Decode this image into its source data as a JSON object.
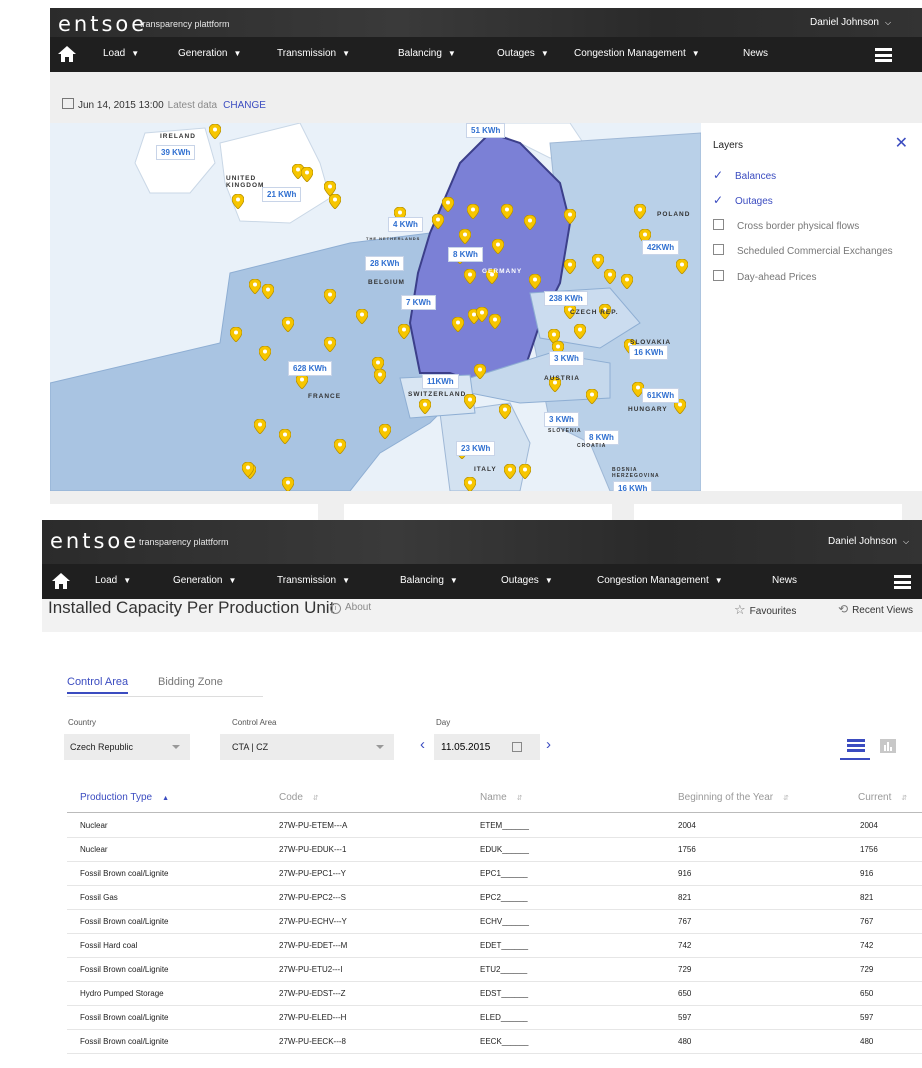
{
  "screenA": {
    "brand": "entsoe",
    "brand_e": "e",
    "tagline": "transparency plattform",
    "user": "Daniel Johnson",
    "nav": [
      "Load",
      "Generation",
      "Transmission",
      "Balancing",
      "Outages",
      "Congestion Management",
      "News"
    ],
    "date": "Jun 14, 2015 13:00",
    "latest": "Latest data",
    "change": "CHANGE",
    "map": {
      "values": [
        "39 KWh",
        "21 KWh",
        "4 KWh",
        "8 KWh",
        "28 KWh",
        "7 KWh",
        "51 KWh",
        "42KWh",
        "238 KWh",
        "628 KWh",
        "11KWh",
        "3 KWh",
        "8 KWh",
        "61KWh",
        "16 KWh",
        "3 KWh",
        "23 KWh",
        "16 KWh"
      ],
      "countries": [
        "IRELAND",
        "UNITED KINGDOM",
        "POLAND",
        "GERMANY",
        "BELGIUM",
        "CZECH REP.",
        "SLOVAKIA",
        "AUSTRIA",
        "HUNGARY",
        "SWITZERLAND",
        "FRANCE",
        "SLOVENIA",
        "CROATIA",
        "BOSNIA HERZEGOVINA",
        "ITALY",
        "THE NETHERLANDS"
      ],
      "colors": {
        "germany": "#7b80d6",
        "neighbors": "#b6cde6",
        "background": "#e8f0f8",
        "marker": "#f7c600"
      }
    },
    "layers": {
      "title": "Layers",
      "items": [
        {
          "label": "Balances",
          "checked": true
        },
        {
          "label": "Outages",
          "checked": true
        },
        {
          "label": "Cross border physical flows",
          "checked": false
        },
        {
          "label": "Scheduled Commercial Exchanges",
          "checked": false
        },
        {
          "label": "Day-ahead Prices",
          "checked": false
        }
      ]
    }
  },
  "screenB": {
    "brand": "entsoe",
    "brand_e": "e",
    "tagline": "transparency plattform",
    "user": "Daniel Johnson",
    "nav": [
      "Load",
      "Generation",
      "Transmission",
      "Balancing",
      "Outages",
      "Congestion Management",
      "News"
    ],
    "page_title": "Installed Capacity Per Production Unit",
    "about": "About",
    "favourites": "Favourites",
    "recent": "Recent Views",
    "tabs": [
      "Control Area",
      "Bidding Zone"
    ],
    "filters": {
      "country_label": "Country",
      "country_value": "Czech Republic",
      "area_label": "Control Area",
      "area_value": "CTA | CZ",
      "day_label": "Day",
      "day_value": "11.05.2015"
    },
    "table": {
      "headers": [
        "Production Type",
        "Code",
        "Name",
        "Beginning of the Year",
        "Current"
      ],
      "rows": [
        [
          "Nuclear",
          "27W-PU-ETEM---A",
          "ETEM______",
          "2004",
          "2004"
        ],
        [
          "Nuclear",
          "27W-PU-EDUK---1",
          "EDUK______",
          "1756",
          "1756"
        ],
        [
          "Fossil Brown coal/Lignite",
          "27W-PU-EPC1---Y",
          "EPC1______",
          "916",
          "916"
        ],
        [
          "Fossil Gas",
          "27W-PU-EPC2---S",
          "EPC2______",
          "821",
          "821"
        ],
        [
          "Fossil Brown coal/Lignite",
          "27W-PU-ECHV---Y",
          "ECHV______",
          "767",
          "767"
        ],
        [
          "Fossil Hard coal",
          "27W-PU-EDET---M",
          "EDET______",
          "742",
          "742"
        ],
        [
          "Fossil Brown coal/Lignite",
          "27W-PU-ETU2---I",
          "ETU2______",
          "729",
          "729"
        ],
        [
          "Hydro Pumped Storage",
          "27W-PU-EDST---Z",
          "EDST______",
          "650",
          "650"
        ],
        [
          "Fossil Brown coal/Lignite",
          "27W-PU-ELED---H",
          "ELED______",
          "597",
          "597"
        ],
        [
          "Fossil Brown coal/Lignite",
          "27W-PU-EECK---8",
          "EECK______",
          "480",
          "480"
        ]
      ]
    }
  }
}
